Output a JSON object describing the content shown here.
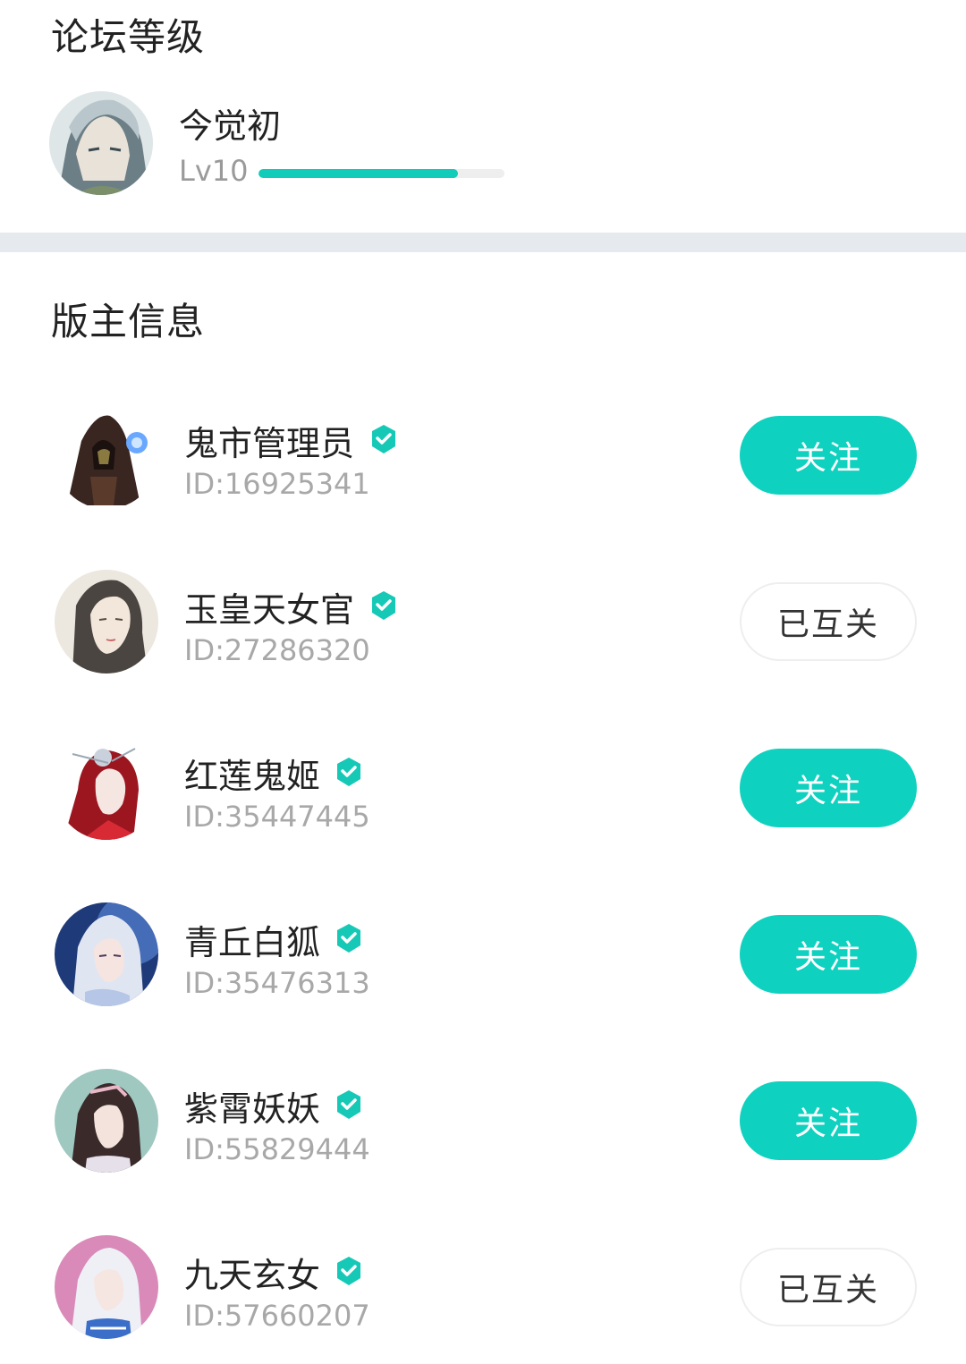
{
  "forum_level": {
    "title": "论坛等级",
    "user": {
      "name": "今觉初",
      "level_label": "Lv10",
      "level_progress": 0.81
    }
  },
  "moderators": {
    "title": "版主信息",
    "items": [
      {
        "name": "鬼市管理员",
        "id": "ID:16925341",
        "button": "关注",
        "state": "follow"
      },
      {
        "name": "玉皇天女官",
        "id": "ID:27286320",
        "button": "已互关",
        "state": "mutual"
      },
      {
        "name": "红莲鬼姬",
        "id": "ID:35447445",
        "button": "关注",
        "state": "follow"
      },
      {
        "name": "青丘白狐",
        "id": "ID:35476313",
        "button": "关注",
        "state": "follow"
      },
      {
        "name": "紫霄妖妖",
        "id": "ID:55829444",
        "button": "关注",
        "state": "follow"
      },
      {
        "name": "九天玄女",
        "id": "ID:57660207",
        "button": "已互关",
        "state": "mutual"
      }
    ]
  },
  "colors": {
    "accent": "#0fd1bf",
    "badge": "#16c9b6",
    "divider": "#e6eaee"
  },
  "icons": {
    "verified": "verified-badge-icon"
  }
}
